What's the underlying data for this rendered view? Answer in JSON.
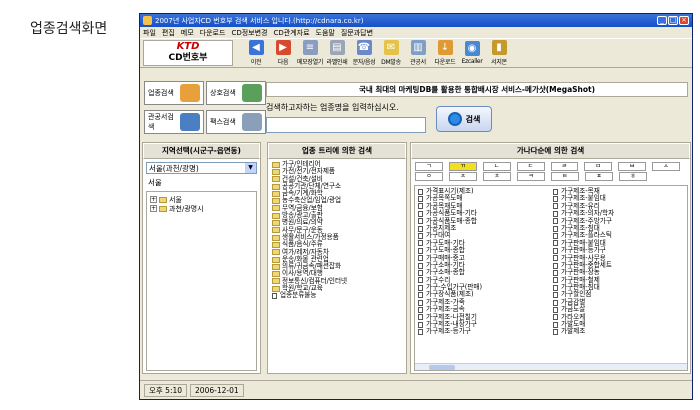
{
  "caption": "업종검색화면",
  "window": {
    "title": "2007년 사업자CD 번호부 검색 서비스 입니다.(http://cdnara.co.kr)"
  },
  "menu": [
    "파일",
    "편집",
    "메모",
    "다운로드",
    "CD정보변경",
    "CD관계자료",
    "도움말",
    "질문과답변"
  ],
  "logo": {
    "brand": "KTD",
    "sub": "CD번호부"
  },
  "toolbar": [
    {
      "label": "이전",
      "icon": "back-arrow-icon",
      "color": "#3a74d8"
    },
    {
      "label": "다음",
      "icon": "forward-arrow-icon",
      "color": "#d64b2b"
    },
    {
      "label": "메모장열기",
      "icon": "notepad-icon",
      "color": "#8a9cc0"
    },
    {
      "label": "라벨인쇄",
      "icon": "label-print-icon",
      "color": "#9aa6b6"
    },
    {
      "label": "문자/음성",
      "icon": "sms-voice-icon",
      "color": "#6a89c8"
    },
    {
      "label": "DM발송",
      "icon": "dm-mail-icon",
      "color": "#e5c34a"
    },
    {
      "label": "관공서",
      "icon": "public-office-icon",
      "color": "#7fa0c4"
    },
    {
      "label": "다운로드",
      "icon": "download-icon",
      "color": "#e09a34"
    },
    {
      "label": "Ezcaller",
      "icon": "ezcaller-icon",
      "color": "#4a88d4"
    },
    {
      "label": "서지몬",
      "icon": "book-icon",
      "color": "#c59a2a"
    }
  ],
  "side_buttons": [
    "업종검색",
    "상호검색",
    "관공서검색",
    "팩스검색"
  ],
  "banner": "국내 최대의 마케팅DB를 활용한 통합배시장 서비스-메가샷(MegaShot)",
  "search": {
    "hint": "검색하고자하는 업종명을 입력하십시오.",
    "button": "검색"
  },
  "region": {
    "header": "지역선택(시군구-읍면동)",
    "combo": "서울(과천/광명)",
    "selected": "서울",
    "tree": [
      "서울",
      "과천/광명시"
    ]
  },
  "category_panel": {
    "header": "업종 트리에 의한 검색",
    "items": [
      "가구/인테리어",
      "가전/전기/전자제품",
      "건설/건축/설비",
      "공공기관/단체/연구소",
      "금속/기계/화학",
      "농수축산업/임업/광업",
      "무역/금융/보험",
      "방송/광고/출판",
      "병원/의료/의약",
      "사무/문구/운동",
      "생활서비스/가정용품",
      "식품/음식/주류",
      "여가/레저/자동차",
      "운송/화물 관련업",
      "의류/귀금속/패션잡화",
      "이사/용역/대행",
      "정보통신/컴퓨터/인터넷",
      "학원/학교/교육",
      "업종분류불능"
    ]
  },
  "alpha_panel": {
    "header": "가나다순에 의한 검색",
    "jamo": [
      [
        "ㄱ",
        "ㄲ",
        "ㄴ",
        "ㄷ",
        "ㄹ",
        "ㅁ",
        "ㅂ",
        "ㅅ"
      ],
      [
        "ㅇ",
        "ㅈ",
        "ㅊ",
        "ㅋ",
        "ㅌ",
        "ㅍ",
        "ㅎ"
      ]
    ],
    "active": "ㄲ",
    "col1": [
      "가격표시기(제조)",
      "가공목쪽도매",
      "가공목재도매",
      "가공식품도매-기타",
      "가공식품도매-종합",
      "가공지제조",
      "가구대여",
      "가구도매-기타",
      "가구도매-종합",
      "가구매매-중고",
      "가구소매-기타",
      "가구소매-종합",
      "가구수리",
      "가구-수입가구(판매)",
      "가구장식품(제조)",
      "가구제조-가죽",
      "가구제조-금속",
      "가구제조-나전칠기",
      "가구제조-내장가구",
      "가구제조-등가구"
    ],
    "col2": [
      "가구제조-목재",
      "가구제조-붙임대",
      "가구제조-유리",
      "가구제조-의자/학자",
      "가구제조-주방가구",
      "가구제조-침대",
      "가구제조-플라스틱",
      "가구판매-붙임대",
      "가구판매-등가구",
      "가구판매-사무용",
      "가구판매-중합세트",
      "가구판매-장농",
      "가구판매-철제",
      "가구판매-침대",
      "가구할인점",
      "가금감별",
      "가금도살",
      "가라오케",
      "가발도매",
      "가발제조"
    ]
  },
  "status": {
    "time": "오후 5:10",
    "date": "2006-12-01"
  }
}
